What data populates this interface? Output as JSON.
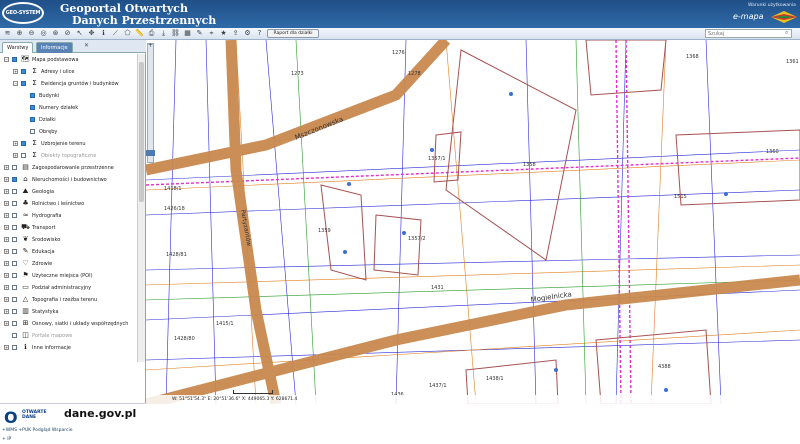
{
  "header": {
    "logo": "GEO-SYSTEM",
    "title_line1": "Geoportal Otwartych",
    "title_line2": "Danych Przestrzennych",
    "top_link": "Warunki użytkowania",
    "brand": "e-mapa"
  },
  "toolbar": {
    "raport_label": "Raport dla działki",
    "search_placeholder": "Szukaj"
  },
  "tabs": {
    "layers": "Warstwy",
    "info": "Informacje",
    "close": "✕"
  },
  "tree": [
    {
      "label": "Mapa podstawowa",
      "level": 0,
      "checked": true,
      "expander": "−",
      "icon": "map-icon"
    },
    {
      "label": "Adresy i ulice",
      "level": 1,
      "checked": true,
      "expander": "+",
      "icon": "layer-group-icon"
    },
    {
      "label": "Ewidencja gruntów i budynków",
      "level": 1,
      "checked": true,
      "expander": "−",
      "icon": "layer-group-icon"
    },
    {
      "label": "Budynki",
      "level": 2,
      "checked": true,
      "expander": "",
      "icon": ""
    },
    {
      "label": "Numery działek",
      "level": 2,
      "checked": true,
      "expander": "",
      "icon": ""
    },
    {
      "label": "Działki",
      "level": 2,
      "checked": true,
      "expander": "",
      "icon": ""
    },
    {
      "label": "Obręby",
      "level": 2,
      "checked": false,
      "expander": "",
      "icon": ""
    },
    {
      "label": "Uzbrojenie terenu",
      "level": 1,
      "checked": true,
      "expander": "+",
      "icon": "layer-group-icon"
    },
    {
      "label": "Obiekty topograficzne",
      "level": 1,
      "checked": false,
      "expander": "+",
      "icon": "layer-group-icon",
      "grey": true
    },
    {
      "label": "Zagospodarowanie przestrzenne",
      "level": 0,
      "checked": false,
      "expander": "+",
      "icon": "planning-icon"
    },
    {
      "label": "Nieruchomości i budownictwo",
      "level": 0,
      "checked": true,
      "expander": "+",
      "icon": "building-icon"
    },
    {
      "label": "Geologia",
      "level": 0,
      "checked": false,
      "expander": "+",
      "icon": "geology-icon"
    },
    {
      "label": "Rolnictwo i leśnictwo",
      "level": 0,
      "checked": false,
      "expander": "+",
      "icon": "tree-icon"
    },
    {
      "label": "Hydrografia",
      "level": 0,
      "checked": false,
      "expander": "+",
      "icon": "water-icon"
    },
    {
      "label": "Transport",
      "level": 0,
      "checked": false,
      "expander": "+",
      "icon": "transport-icon"
    },
    {
      "label": "Środowisko",
      "level": 0,
      "checked": false,
      "expander": "+",
      "icon": "leaf-icon"
    },
    {
      "label": "Edukacja",
      "level": 0,
      "checked": false,
      "expander": "+",
      "icon": "education-icon"
    },
    {
      "label": "Zdrowie",
      "level": 0,
      "checked": false,
      "expander": "+",
      "icon": "heart-icon"
    },
    {
      "label": "Użyteczne miejsca (POI)",
      "level": 0,
      "checked": false,
      "expander": "+",
      "icon": "poi-icon"
    },
    {
      "label": "Podział administracyjny",
      "level": 0,
      "checked": false,
      "expander": "+",
      "icon": "admin-icon"
    },
    {
      "label": "Topografia i rzeźba terenu",
      "level": 0,
      "checked": false,
      "expander": "+",
      "icon": "terrain-icon"
    },
    {
      "label": "Statystyka",
      "level": 0,
      "checked": false,
      "expander": "+",
      "icon": "statistics-icon"
    },
    {
      "label": "Osnowy, siatki i układy współrzędnych",
      "level": 0,
      "checked": false,
      "expander": "+",
      "icon": "grid-icon"
    },
    {
      "label": "Portale mapowe",
      "level": 0,
      "checked": false,
      "expander": "",
      "icon": "portal-icon",
      "grey": true
    },
    {
      "label": "Inne informacje",
      "level": 0,
      "checked": false,
      "expander": "+",
      "icon": "info-icon"
    }
  ],
  "footer": {
    "od_line1": "OTWARTE",
    "od_line2": "DANE",
    "dane": "dane.gov.pl",
    "links": "+WMS  +PUK  Podgląd  Wsparcie",
    "ip": "+ IP"
  },
  "status": {
    "coords": "W: 51°51'54.3\"  E: 20°51'36.6\"  X: 449065.3  Y: 628671.4"
  },
  "map": {
    "streets": [
      "Mszczonowska",
      "Mogielnicka",
      "Partyzantów"
    ],
    "parcels": [
      "1273",
      "1276",
      "1278",
      "1357/1",
      "1358",
      "1359",
      "1357/2",
      "1360",
      "1361",
      "1368",
      "1418/1",
      "1426/18",
      "1428/81",
      "1428/80",
      "1431",
      "1436",
      "1437/1",
      "1438/1",
      "4388",
      "1515",
      "1415/1"
    ]
  }
}
